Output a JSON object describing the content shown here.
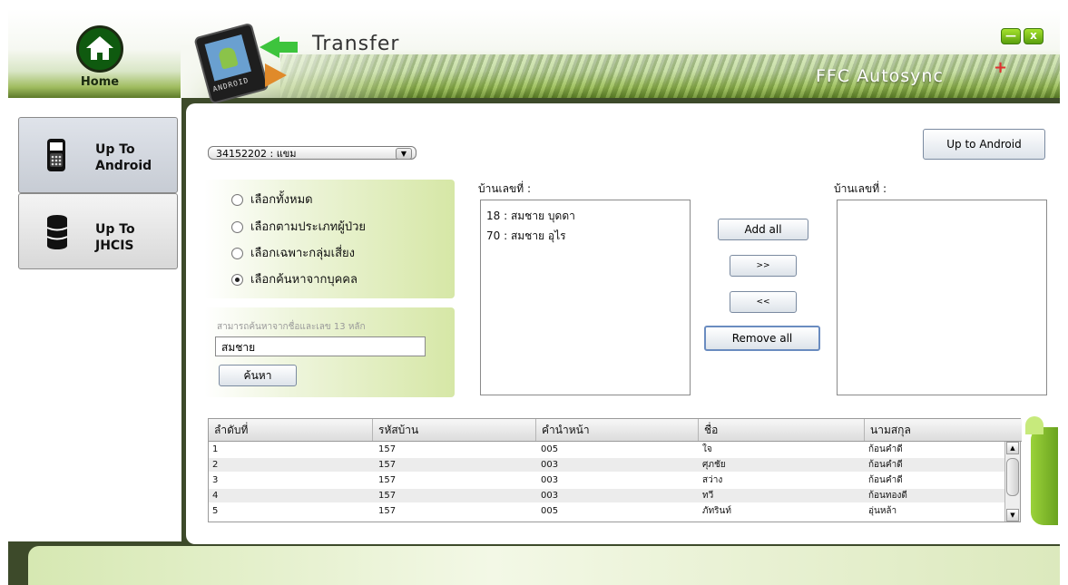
{
  "header": {
    "title": "Transfer",
    "brand": "FFC Autosync",
    "brand_plus": "+",
    "home_label": "Home",
    "logo_text": "ANDROID",
    "minimize_label": "—",
    "close_label": "x"
  },
  "nav": {
    "items": [
      {
        "line1": "Up To",
        "line2": "Android",
        "icon": "phone-icon",
        "active": true
      },
      {
        "line1": "Up To",
        "line2": "JHCIS",
        "icon": "database-icon",
        "active": false
      }
    ]
  },
  "main": {
    "village_select": "34152202 : แขม",
    "up_button": "Up to Android",
    "filter_options": [
      {
        "label": "เลือกทั้งหมด",
        "checked": false
      },
      {
        "label": "เลือกตามประเภทผู้ป่วย",
        "checked": false
      },
      {
        "label": "เลือกเฉพาะกลุ่มเสี่ยง",
        "checked": false
      },
      {
        "label": "เลือกค้นหาจากบุคคล",
        "checked": true
      }
    ],
    "search": {
      "hint": "สามารถค้นหาจากชื่อและเลข 13 หลัก",
      "value": "สมชาย",
      "button": "ค้นหา"
    },
    "left_list": {
      "label": "บ้านเลขที่ :",
      "items": [
        "18 : สมชาย บุดดา",
        "70 : สมชาย อุไร"
      ]
    },
    "right_list": {
      "label": "บ้านเลขที่ :",
      "items": []
    },
    "transfer_buttons": {
      "add_all": "Add all",
      "add": ">>",
      "remove": "<<",
      "remove_all": "Remove all"
    },
    "table": {
      "columns": [
        "ลำดับที่",
        "รหัสบ้าน",
        "คำนำหน้า",
        "ชื่อ",
        "นามสกุล"
      ],
      "rows": [
        [
          "1",
          "157",
          "005",
          "ใจ",
          "ก้อนคำดี"
        ],
        [
          "2",
          "157",
          "003",
          "ศุภชัย",
          "ก้อนคำดี"
        ],
        [
          "3",
          "157",
          "003",
          "สว่าง",
          "ก้อนคำดี"
        ],
        [
          "4",
          "157",
          "003",
          "ทวี",
          "ก้อนทองดี"
        ],
        [
          "5",
          "157",
          "005",
          "ภัทรินท์",
          "อุ่นหล้า"
        ]
      ]
    }
  },
  "colors": {
    "frame": "#3d4a2a",
    "accent_green": "#6aa31f",
    "panel_green": "#d6e7a6"
  }
}
